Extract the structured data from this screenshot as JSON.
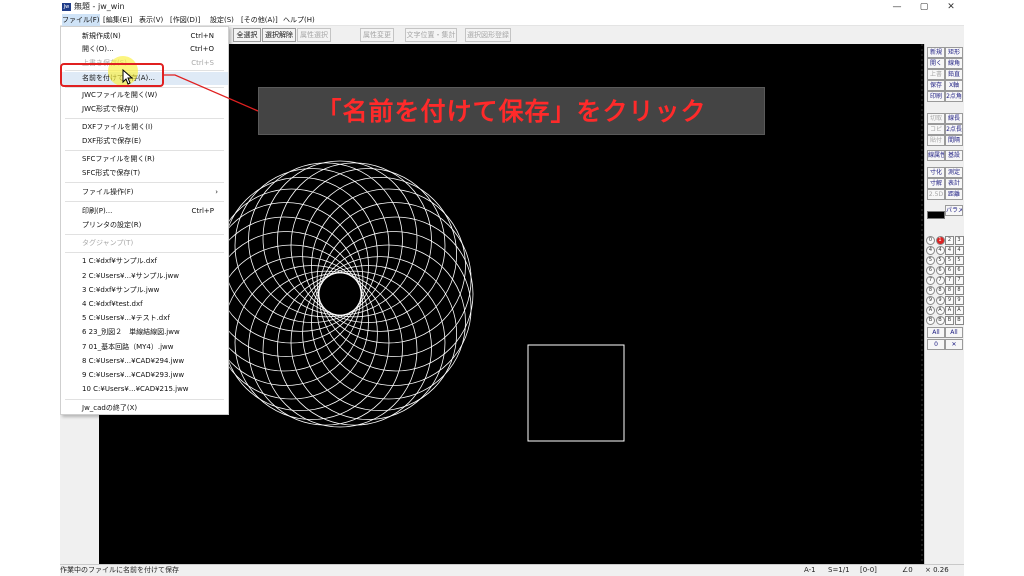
{
  "window": {
    "title": "無題 - jw_win",
    "app_icon_text": "Jw",
    "minimize": "—",
    "restore": "▢",
    "close": "✕"
  },
  "menubar": {
    "items": [
      "ファイル(F)",
      "[編集(E)]",
      "表示(V)",
      "[作図(D)]",
      "設定(S)",
      "[その他(A)]",
      "ヘルプ(H)"
    ]
  },
  "toolbar": {
    "buttons": [
      "全選択",
      "選択解除",
      "属性選択",
      "属性変更",
      "文字位置・集計",
      "選択図形登録"
    ]
  },
  "file_menu": {
    "items": [
      {
        "label": "新規作成(N)",
        "shortcut": "Ctrl+N"
      },
      {
        "label": "開く(O)...",
        "shortcut": "Ctrl+O"
      },
      {
        "label": "上書き保存(S)",
        "shortcut": "Ctrl+S"
      },
      {
        "label": "名前を付けて保存(A)..."
      },
      {
        "label": "JWCファイルを開く(W)"
      },
      {
        "label": "JWC形式で保存(J)"
      },
      {
        "label": "DXFファイルを開く(I)"
      },
      {
        "label": "DXF形式で保存(E)"
      },
      {
        "label": "SFCファイルを開く(R)"
      },
      {
        "label": "SFC形式で保存(T)"
      },
      {
        "label": "ファイル操作(F)",
        "arrow": "›"
      },
      {
        "label": "印刷(P)...",
        "shortcut": "Ctrl+P"
      },
      {
        "label": "プリンタの設定(R)"
      },
      {
        "label": "タグジャンプ(T)"
      },
      {
        "label": "1 C:¥dxf¥サンプル.dxf"
      },
      {
        "label": "2 C:¥Users¥...¥サンプル.jww"
      },
      {
        "label": "3 C:¥dxf¥サンプル.jww"
      },
      {
        "label": "4 C:¥dxf¥test.dxf"
      },
      {
        "label": "5 C:¥Users¥...¥テスト.dxf"
      },
      {
        "label": "6 23_別図２　単線結線図.jww"
      },
      {
        "label": "7 01_基本回路（MY4）.jww"
      },
      {
        "label": "8 C:¥Users¥...¥CAD¥294.jww"
      },
      {
        "label": "9 C:¥Users¥...¥CAD¥293.jww"
      },
      {
        "label": "10 C:¥Users¥...¥CAD¥215.jww"
      },
      {
        "label": "Jw_cadの終了(X)"
      }
    ]
  },
  "right_panel": {
    "buttons": [
      "新規",
      "矩形",
      "開く",
      "線角",
      "上書",
      "鉛直",
      "保存",
      "X軸",
      "印刷",
      "2点角",
      "切取",
      "線長",
      "コピ",
      "2点長",
      "貼付",
      "間隔",
      "線属性",
      "基設",
      "寸化",
      "測定",
      "寸解",
      "表計",
      "2.5D",
      "距離",
      "式計",
      "パラメ"
    ],
    "layer_top": [
      "0",
      "1",
      "2",
      "3"
    ],
    "layer_cells": [
      "4",
      "5",
      "6",
      "7",
      "8",
      "9",
      "A",
      "B",
      "C",
      "D",
      "E",
      "F"
    ],
    "all_left": "All",
    "all_right": "All",
    "group_num": "0",
    "group_x": "✕"
  },
  "status": {
    "message": "作業中のファイルに名前を付けて保存",
    "paper": "A-1",
    "scale": "S=1/1",
    "layer": "[0-0]",
    "angle": "∠0",
    "zoom": "× 0.26"
  },
  "annotation": {
    "callout_text": "「名前を付けて保存」をクリック"
  },
  "colors": {
    "accent": "#e02020",
    "callout_bg": "#444444",
    "canvas_bg": "#000000"
  }
}
